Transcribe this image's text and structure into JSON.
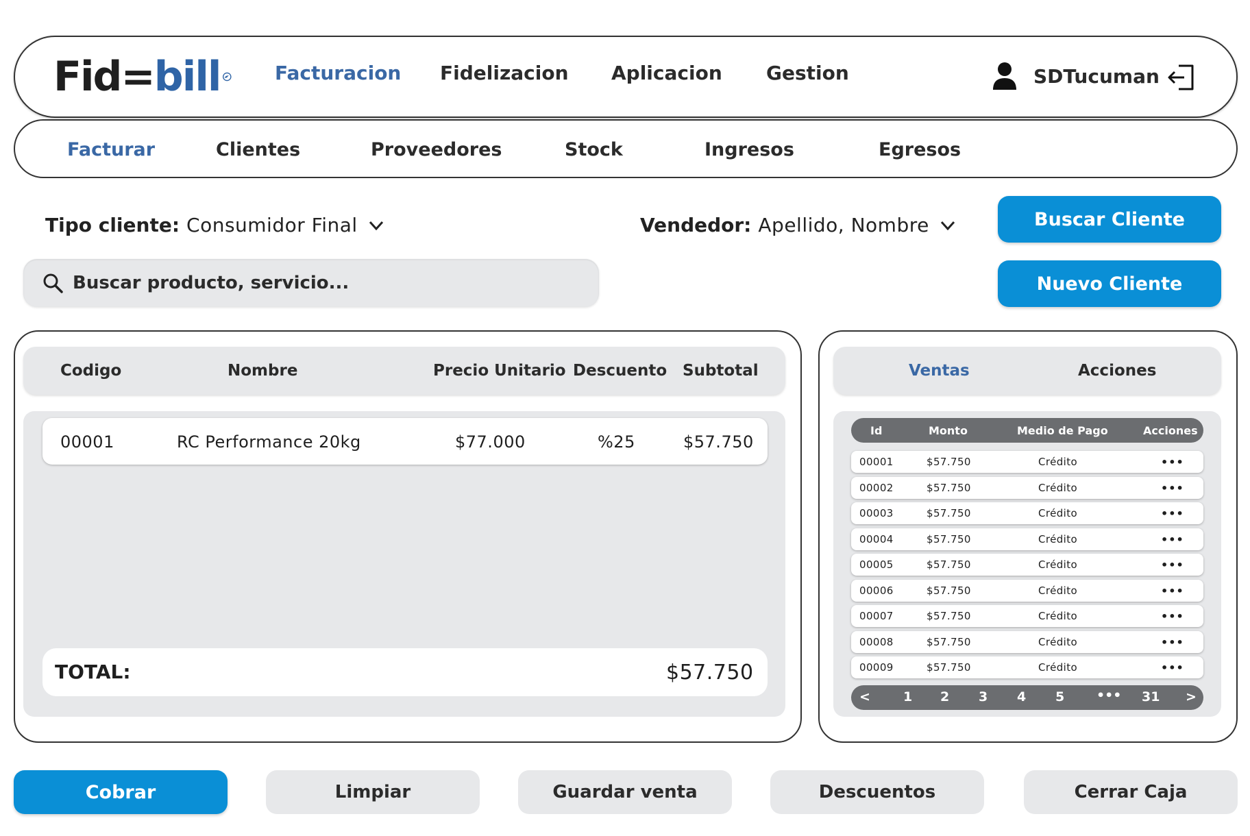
{
  "brand": {
    "logo_text_left": "Fid",
    "logo_text_mid": "=",
    "logo_text_right": "bill",
    "colors": {
      "dark": "#1f1f1f",
      "blue": "#2f64a6"
    }
  },
  "top_nav": {
    "items": [
      "Facturacion",
      "Fidelizacion",
      "Aplicacion",
      "Gestion"
    ],
    "active": "Facturacion",
    "user": "SDTucuman",
    "user_icon": "user-icon",
    "logout_icon": "logout-icon"
  },
  "sub_nav": {
    "items": [
      "Facturar",
      "Clientes",
      "Proveedores",
      "Stock",
      "Ingresos",
      "Egresos"
    ],
    "active": "Facturar"
  },
  "filters": {
    "tipo_label": "Tipo cliente:",
    "tipo_value": "Consumidor Final",
    "vendedor_label": "Vendedor:",
    "vendedor_value": "Apellido, Nombre"
  },
  "actions_top": {
    "buscar_cliente": "Buscar Cliente",
    "nuevo_cliente": "Nuevo Cliente"
  },
  "search": {
    "placeholder": "Buscar producto, servicio..."
  },
  "invoice": {
    "headers": [
      "Codigo",
      "Nombre",
      "Precio Unitario",
      "Descuento",
      "Subtotal"
    ],
    "rows": [
      {
        "codigo": "00001",
        "nombre": "RC Performance 20kg",
        "precio": "$77.000",
        "descuento": "%25",
        "subtotal": "$57.750"
      }
    ],
    "total_label": "TOTAL:",
    "total_value": "$57.750"
  },
  "sales_panel": {
    "tabs": [
      "Ventas",
      "Acciones"
    ],
    "active_tab": "Ventas",
    "headers": [
      "Id",
      "Monto",
      "Medio de Pago",
      "Acciones"
    ],
    "rows": [
      {
        "id": "00001",
        "monto": "$57.750",
        "medio": "Crédito",
        "acciones": "•••"
      },
      {
        "id": "00002",
        "monto": "$57.750",
        "medio": "Crédito",
        "acciones": "•••"
      },
      {
        "id": "00003",
        "monto": "$57.750",
        "medio": "Crédito",
        "acciones": "•••"
      },
      {
        "id": "00004",
        "monto": "$57.750",
        "medio": "Crédito",
        "acciones": "•••"
      },
      {
        "id": "00005",
        "monto": "$57.750",
        "medio": "Crédito",
        "acciones": "•••"
      },
      {
        "id": "00006",
        "monto": "$57.750",
        "medio": "Crédito",
        "acciones": "•••"
      },
      {
        "id": "00007",
        "monto": "$57.750",
        "medio": "Crédito",
        "acciones": "•••"
      },
      {
        "id": "00008",
        "monto": "$57.750",
        "medio": "Crédito",
        "acciones": "•••"
      },
      {
        "id": "00009",
        "monto": "$57.750",
        "medio": "Crédito",
        "acciones": "•••"
      }
    ],
    "pagination": {
      "prev": "<",
      "pages": [
        "1",
        "2",
        "3",
        "4",
        "5",
        "•••",
        "31"
      ],
      "next": ">"
    }
  },
  "bottom_actions": {
    "cobrar": "Cobrar",
    "limpiar": "Limpiar",
    "guardar": "Guardar venta",
    "descuentos": "Descuentos",
    "cerrar_caja": "Cerrar Caja"
  },
  "colors": {
    "accent_blue": "#0a8fd6",
    "nav_active": "#3a68a5",
    "panel_gray": "#e7e8ea",
    "table_header_gray": "#6b6d70"
  }
}
